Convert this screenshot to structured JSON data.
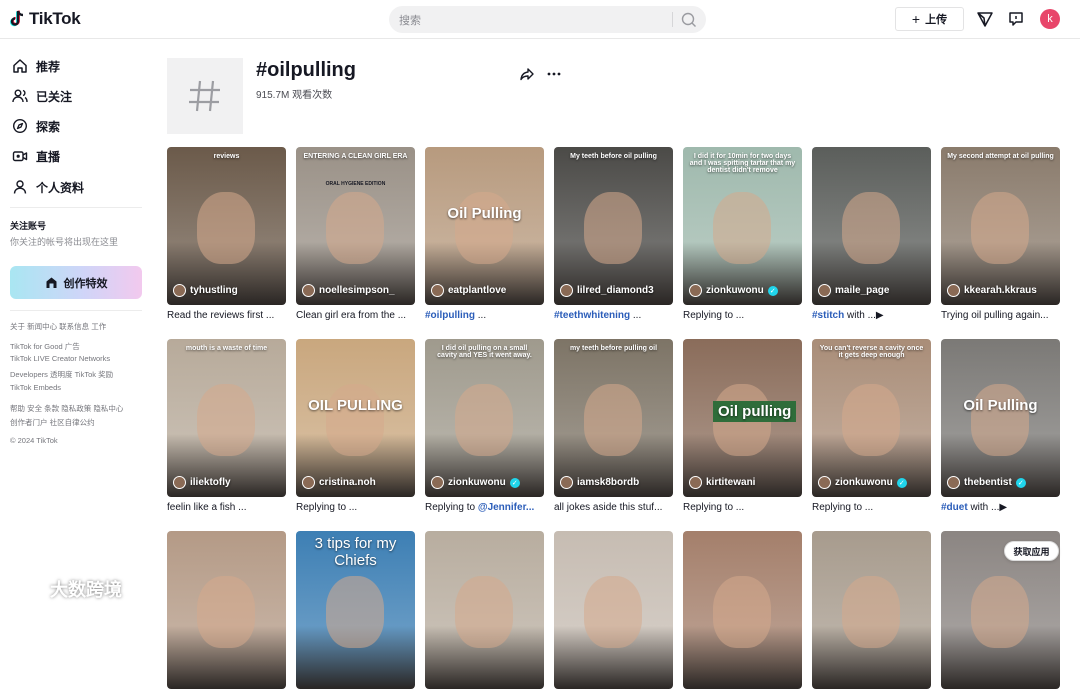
{
  "app": {
    "name": "TikTok"
  },
  "header": {
    "search_placeholder": "搜索",
    "upload_label": "上传",
    "avatar_letter": "k"
  },
  "sidebar": {
    "nav": [
      {
        "label": "推荐",
        "icon": "home-icon"
      },
      {
        "label": "已关注",
        "icon": "following-icon"
      },
      {
        "label": "探索",
        "icon": "explore-icon"
      },
      {
        "label": "直播",
        "icon": "live-icon"
      },
      {
        "label": "个人资料",
        "icon": "profile-icon"
      }
    ],
    "following_title": "关注账号",
    "following_sub": "你关注的帐号将出现在这里",
    "effect_button": "创作特效",
    "footer": [
      "关于  新闻中心  联系信息  工作",
      "TikTok for Good  广告",
      "TikTok LIVE Creator Networks",
      "Developers  透明度  TikTok 奖励",
      "TikTok Embeds",
      "帮助  安全  条款  隐私政策  隐私中心",
      "创作者门户  社区自律公约",
      "© 2024 TikTok"
    ]
  },
  "hashtag": {
    "title": "#oilpulling",
    "views": "915.7M 观看次数"
  },
  "videos": [
    {
      "user": "tyhustling",
      "verified": false,
      "caption": "Read the reviews first ...",
      "overlay": "reviews",
      "bg": "#6b5a4a"
    },
    {
      "user": "noellesimpson_",
      "verified": false,
      "caption": "Clean girl era from the ...",
      "overlay": "ENTERING A CLEAN GIRL ERA",
      "overlay2": "ORAL HYGIENE EDITION",
      "bg": "#9a9187"
    },
    {
      "user": "eatplantlove",
      "verified": false,
      "caption_hl": "#oilpulling",
      "caption": " ...",
      "overlay": "Oil Pulling",
      "bg": "#b79a7e"
    },
    {
      "user": "lilred_diamond3",
      "verified": false,
      "caption_hl": "#teethwhitening",
      "caption": " ...",
      "overlay": "My teeth before oil pulling",
      "bg": "#4b4a47"
    },
    {
      "user": "zionkuwonu",
      "verified": true,
      "caption": "Replying to ...",
      "overlay": "I did it for 10min for two days and I was spitting tartar that my dentist didn't remove",
      "bg": "#9fb9ad"
    },
    {
      "user": "maile_page",
      "verified": false,
      "caption_hl": "#stitch",
      "caption": " with ...▶",
      "overlay": "",
      "bg": "#5b5e5b"
    },
    {
      "user": "kkearah.kkraus",
      "verified": false,
      "caption": "Trying oil pulling again...",
      "overlay": "My second attempt at oil pulling",
      "bg": "#8a7b6c"
    },
    {
      "user": "iliektofly",
      "verified": false,
      "caption": "feelin like a fish ...",
      "overlay": "mouth is a waste of time",
      "bg": "#b7aa9a"
    },
    {
      "user": "cristina.noh",
      "verified": false,
      "caption": "Replying to ...",
      "overlay": "OIL PULLING",
      "bg": "#c9a77e"
    },
    {
      "user": "zionkuwonu",
      "verified": true,
      "caption": "Replying to ",
      "caption_hl": "@Jennifer...",
      "overlay": "I did oil pulling on a small cavity and YES it went away.",
      "bg": "#9f9a8d"
    },
    {
      "user": "iamsk8bordb",
      "verified": false,
      "caption": "all jokes aside this stuf...",
      "overlay": "my teeth before pulling oil",
      "bg": "#7d7466"
    },
    {
      "user": "kirtitewani",
      "verified": false,
      "caption": "Replying to ...",
      "overlay": "Oil pulling",
      "bg": "#8a6c5a"
    },
    {
      "user": "zionkuwonu",
      "verified": true,
      "caption": "Replying to ...",
      "overlay": "You can't reverse a cavity once it gets deep enough",
      "bg": "#a98d78"
    },
    {
      "user": "thebentist",
      "verified": true,
      "caption_hl": "#duet",
      "caption": " with ...▶",
      "overlay": "Oil Pulling",
      "bg": "#7b7976"
    },
    {
      "user": "",
      "verified": false,
      "caption": "",
      "overlay": "",
      "bg": "#b49a86"
    },
    {
      "user": "",
      "verified": false,
      "caption": "",
      "overlay": "3 tips for my Chiefs",
      "bg": "#3d7fb4"
    },
    {
      "user": "",
      "verified": false,
      "caption": "",
      "overlay": "",
      "bg": "#b8ad9f"
    },
    {
      "user": "",
      "verified": false,
      "caption": "",
      "overlay": "",
      "bg": "#c6bcb2"
    },
    {
      "user": "",
      "verified": false,
      "caption": "",
      "overlay": "",
      "bg": "#a47f6b"
    },
    {
      "user": "",
      "verified": false,
      "caption": "",
      "overlay": "",
      "bg": "#a79b8d"
    },
    {
      "user": "",
      "verified": false,
      "caption": "",
      "overlay": "",
      "bg": "#8b8582"
    }
  ],
  "watermark": "大数跨境",
  "get_app": "获取应用"
}
